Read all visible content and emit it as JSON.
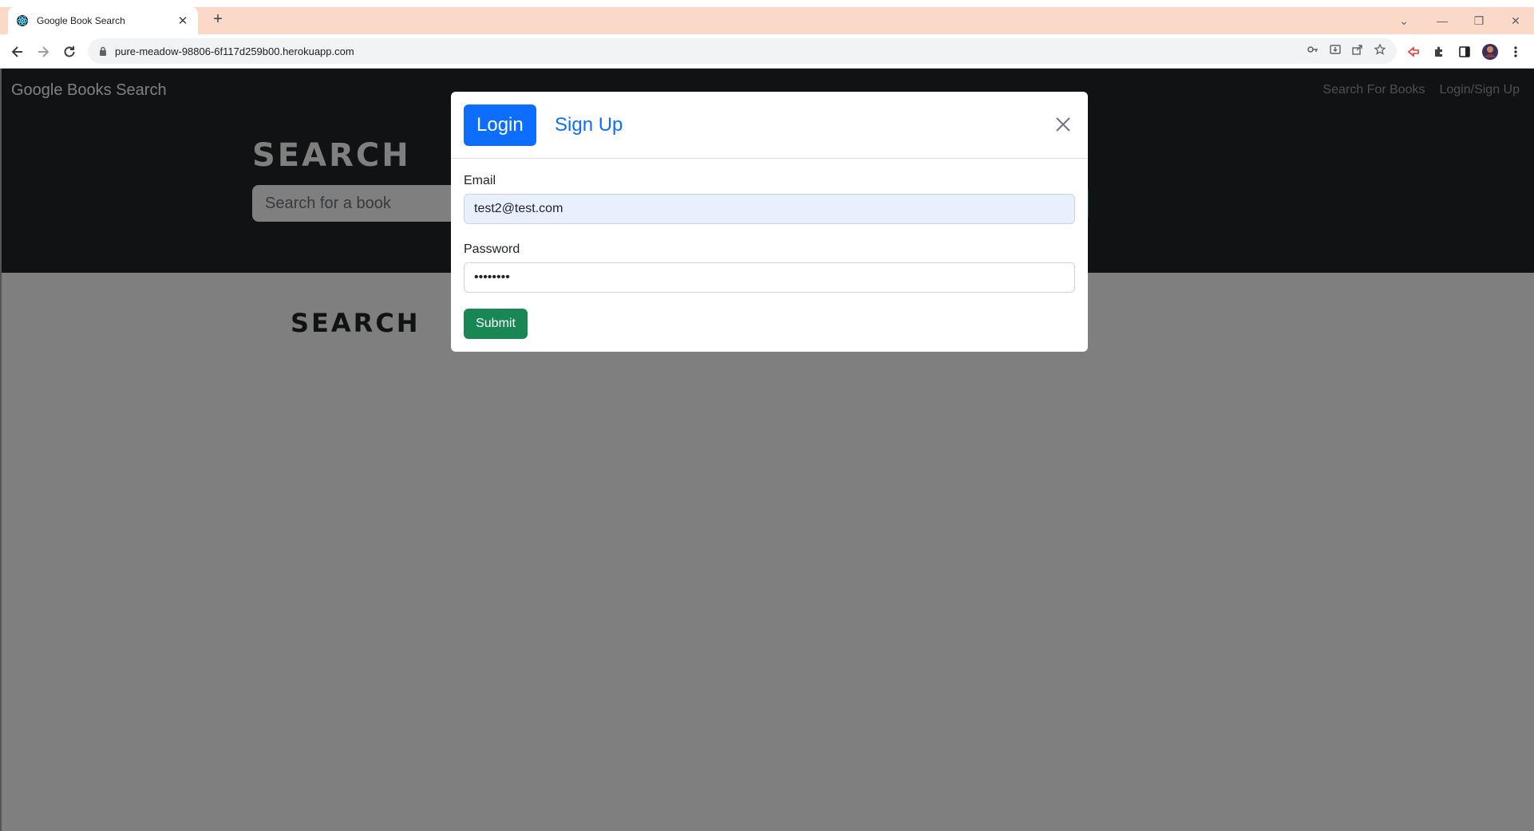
{
  "browser": {
    "tab_title": "Google Book Search",
    "new_tab_label": "+",
    "url": "pure-meadow-98806-6f117d259b00.herokuapp.com"
  },
  "navbar": {
    "brand": "Google Books Search",
    "links": [
      "Search For Books",
      "Login/Sign Up"
    ]
  },
  "hero": {
    "title": "SEARCH",
    "search_placeholder": "Search for a book"
  },
  "results": {
    "title": "SEARCH"
  },
  "modal": {
    "tabs": [
      {
        "label": "Login",
        "active": true
      },
      {
        "label": "Sign Up",
        "active": false
      }
    ],
    "email_label": "Email",
    "email_value": "test2@test.com",
    "password_label": "Password",
    "password_value": "••••••••",
    "submit_label": "Submit"
  },
  "colors": {
    "primary": "#0d6efd",
    "success": "#198754",
    "dark": "#212529",
    "tabstrip": "#fad9c8"
  }
}
